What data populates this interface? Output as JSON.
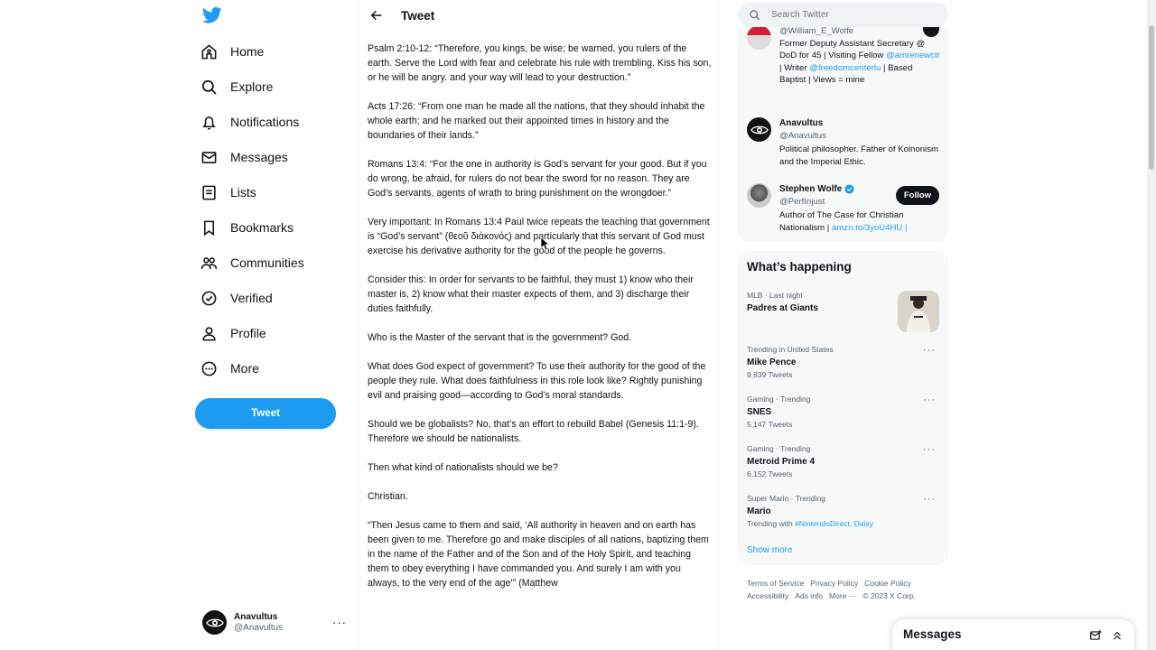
{
  "nav": {
    "items": [
      {
        "label": "Home",
        "icon": "home-icon"
      },
      {
        "label": "Explore",
        "icon": "search-icon"
      },
      {
        "label": "Notifications",
        "icon": "bell-icon"
      },
      {
        "label": "Messages",
        "icon": "mail-icon"
      },
      {
        "label": "Lists",
        "icon": "list-icon"
      },
      {
        "label": "Bookmarks",
        "icon": "bookmark-icon"
      },
      {
        "label": "Communities",
        "icon": "communities-icon"
      },
      {
        "label": "Verified",
        "icon": "verified-icon"
      },
      {
        "label": "Profile",
        "icon": "profile-icon"
      },
      {
        "label": "More",
        "icon": "more-circle-icon"
      }
    ],
    "tweet_button": "Tweet",
    "account": {
      "name": "Anavultus",
      "handle": "@Anavultus"
    }
  },
  "center": {
    "title": "Tweet",
    "paragraphs": [
      "Psalm 2:10-12: “Therefore, you kings, be wise; be warned, you rulers of the earth. Serve the Lord with fear and celebrate his rule with trembling. Kiss his son, or he will be angry. and your way will lead to your destruction.”",
      "Acts 17:26: “From one man he made all the nations, that they should inhabit the whole earth; and he marked out their appointed times in history and the boundaries of their lands.”",
      "Romans 13:4: “For the one in authority is God’s servant for your good. But if you do wrong, be afraid, for rulers do not bear the sword for no reason. They are God’s servants, agents of wrath to bring punishment on the wrongdoer.”",
      "Very important: In Romans 13:4 Paul twice repeats the teaching that government is “God’s servant” (θεοῦ διάκονός) and particularly that this servant of God must exercise his derivative authority for the good of the people he governs.",
      "Consider this: In order for servants to be faithful, they must 1) know who their master is, 2) know what their master expects of them, and 3) discharge their duties faithfully.",
      "Who is the Master of the servant that is the government? God.",
      "What does God expect of government? To use their authority for the good of the people they rule. What does faithfulness in this role look like? Rightly punishing evil and praising good—according to God’s moral standards.",
      "Should we be globalists? No, that’s an effort to rebuild Babel (Genesis 11:1-9). Therefore we should be nationalists.",
      "Then what kind of nationalists should we be?",
      "Christian.",
      "“Then Jesus came to them and said, ‘All authority in heaven and on earth has been given to me. Therefore go and make disciples of all nations, baptizing them in the name of the Father and of the Son and of the Holy Spirit, and teaching them to obey everything I have commanded you. And surely I am with you always, to the very end of the age’” (Matthew"
    ]
  },
  "search": {
    "placeholder": "Search Twitter"
  },
  "who_to_follow": [
    {
      "handle": "@William_E_Wolfe",
      "bio_parts": [
        "Former Deputy Assistant Secretary @ DoD for 45 | Visiting Fellow ",
        "@amrenewctr",
        " | Writer ",
        "@freedomcenterlu",
        " | Based Baptist | Views = mine"
      ]
    },
    {
      "name": "Anavultus",
      "handle": "@Anavultus",
      "bio": "Political philosopher. Father of Koinonism and the Imperial Ethic."
    },
    {
      "name": "Stephen Wolfe",
      "handle": "@PerfInjust",
      "bio": "Author of The Case for Christian Nationalism | ",
      "bio_link": "amzn.to/3yoU4HU |",
      "button": "Follow"
    }
  ],
  "happening": {
    "title": "What’s happening",
    "trends": [
      {
        "meta": "MLB · Last night",
        "name": "Padres at Giants",
        "count": ""
      },
      {
        "meta": "Trending in United States",
        "name": "Mike Pence",
        "count": "9,839 Tweets"
      },
      {
        "meta": "Gaming · Trending",
        "name": "SNES",
        "count": "5,147 Tweets"
      },
      {
        "meta": "Gaming · Trending",
        "name": "Metroid Prime 4",
        "count": "6,152 Tweets"
      },
      {
        "meta": "Super Mario · Trending",
        "name": "Mario",
        "count_prefix": "Trending with ",
        "count_link": "#NintendoDirect, Daisy"
      }
    ],
    "show_more": "Show more"
  },
  "footer": {
    "links": [
      "Terms of Service",
      "Privacy Policy",
      "Cookie Policy",
      "Accessibility",
      "Ads info",
      "More ···",
      "© 2023 X Corp."
    ]
  },
  "messages_drawer": {
    "title": "Messages"
  },
  "colors": {
    "accent": "#1d9bf0",
    "text": "#0f1419",
    "muted": "#536471"
  }
}
